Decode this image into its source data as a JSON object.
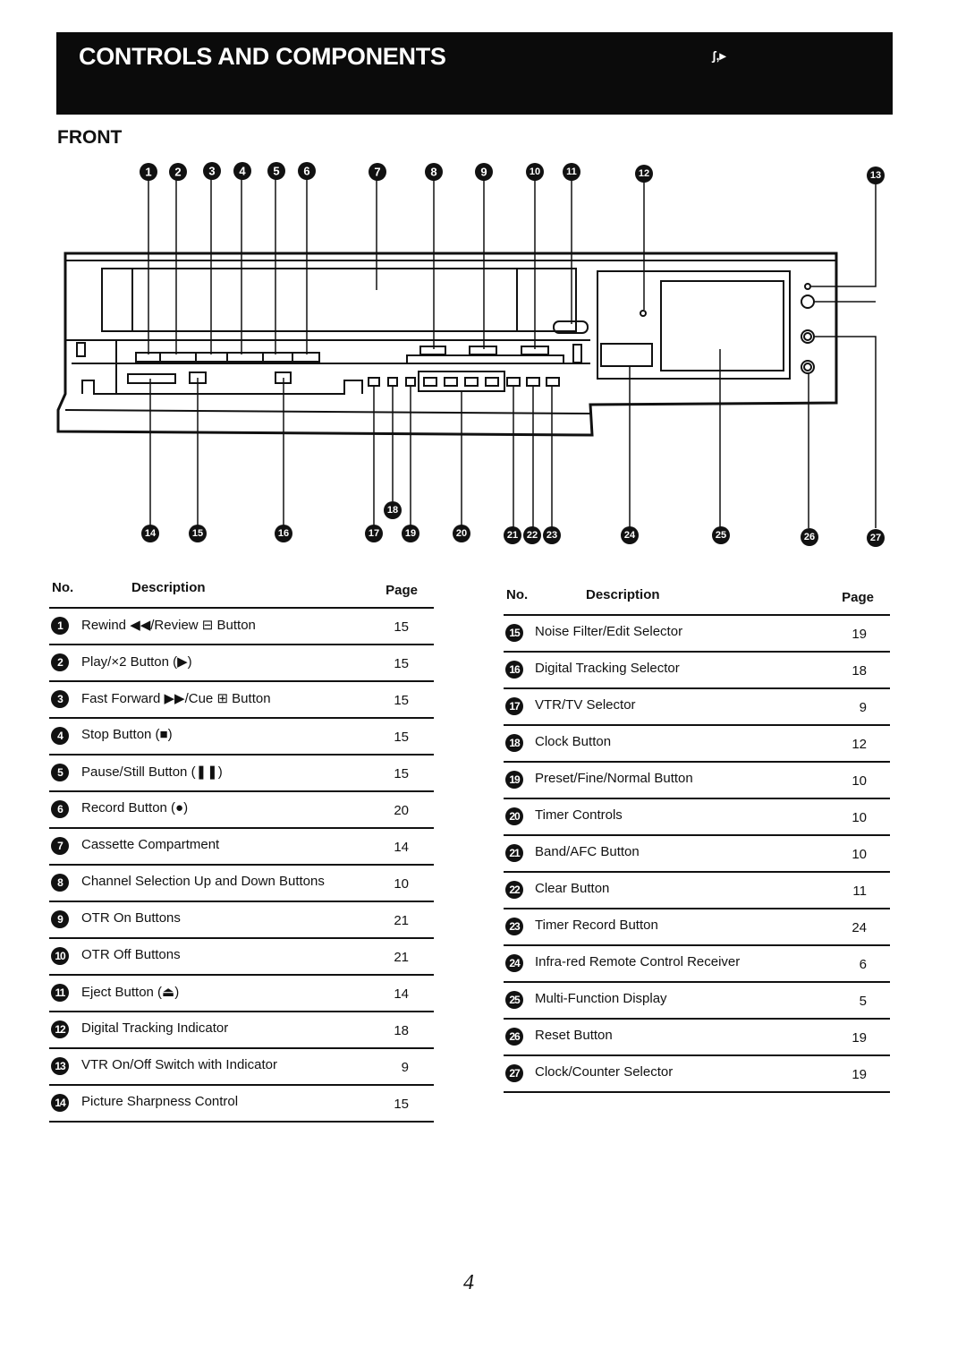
{
  "header": {
    "title": "CONTROLS AND COMPONENTS",
    "mark": "ʃ,▸"
  },
  "section": {
    "title": "FRONT"
  },
  "diagram": {
    "top_callouts": [
      "1",
      "2",
      "3",
      "4",
      "5",
      "6",
      "7",
      "8",
      "9",
      "10",
      "11",
      "12",
      "13"
    ],
    "bottom_callouts": [
      "14",
      "15",
      "16",
      "17",
      "18",
      "19",
      "20",
      "21",
      "22",
      "23",
      "24",
      "25",
      "26",
      "27"
    ]
  },
  "table_headers": {
    "no": "No.",
    "description": "Description",
    "page": "Page"
  },
  "table_left": [
    {
      "no": "1",
      "description": "Rewind ◀◀/Review ⊟ Button",
      "page": "15"
    },
    {
      "no": "2",
      "description": "Play/×2 Button (▶)",
      "page": "15"
    },
    {
      "no": "3",
      "description": "Fast Forward ▶▶/Cue ⊞ Button",
      "page": "15"
    },
    {
      "no": "4",
      "description": "Stop Button (■)",
      "page": "15"
    },
    {
      "no": "5",
      "description": "Pause/Still Button (❚❚)",
      "page": "15"
    },
    {
      "no": "6",
      "description": "Record Button (●)",
      "page": "20"
    },
    {
      "no": "7",
      "description": "Cassette Compartment",
      "page": "14"
    },
    {
      "no": "8",
      "description": "Channel Selection Up and Down Buttons",
      "page": "10"
    },
    {
      "no": "9",
      "description": "OTR On Buttons",
      "page": "21"
    },
    {
      "no": "10",
      "description": "OTR Off Buttons",
      "page": "21"
    },
    {
      "no": "11",
      "description": "Eject Button (⏏)",
      "page": "14"
    },
    {
      "no": "12",
      "description": "Digital Tracking Indicator",
      "page": "18"
    },
    {
      "no": "13",
      "description": "VTR On/Off Switch with Indicator",
      "page": "9"
    },
    {
      "no": "14",
      "description": "Picture Sharpness Control",
      "page": "15"
    }
  ],
  "table_right": [
    {
      "no": "15",
      "description": "Noise Filter/Edit Selector",
      "page": "19"
    },
    {
      "no": "16",
      "description": "Digital Tracking Selector",
      "page": "18"
    },
    {
      "no": "17",
      "description": "VTR/TV Selector",
      "page": "9"
    },
    {
      "no": "18",
      "description": "Clock Button",
      "page": "12"
    },
    {
      "no": "19",
      "description": "Preset/Fine/Normal Button",
      "page": "10"
    },
    {
      "no": "20",
      "description": "Timer Controls",
      "page": "10"
    },
    {
      "no": "21",
      "description": "Band/AFC Button",
      "page": "10"
    },
    {
      "no": "22",
      "description": "Clear Button",
      "page": "11"
    },
    {
      "no": "23",
      "description": "Timer Record Button",
      "page": "24"
    },
    {
      "no": "24",
      "description": "Infra-red Remote Control Receiver",
      "page": "6"
    },
    {
      "no": "25",
      "description": "Multi-Function Display",
      "page": "5"
    },
    {
      "no": "26",
      "description": "Reset Button",
      "page": "19"
    },
    {
      "no": "27",
      "description": "Clock/Counter Selector",
      "page": "19"
    }
  ],
  "footer": {
    "page_number": "4"
  }
}
